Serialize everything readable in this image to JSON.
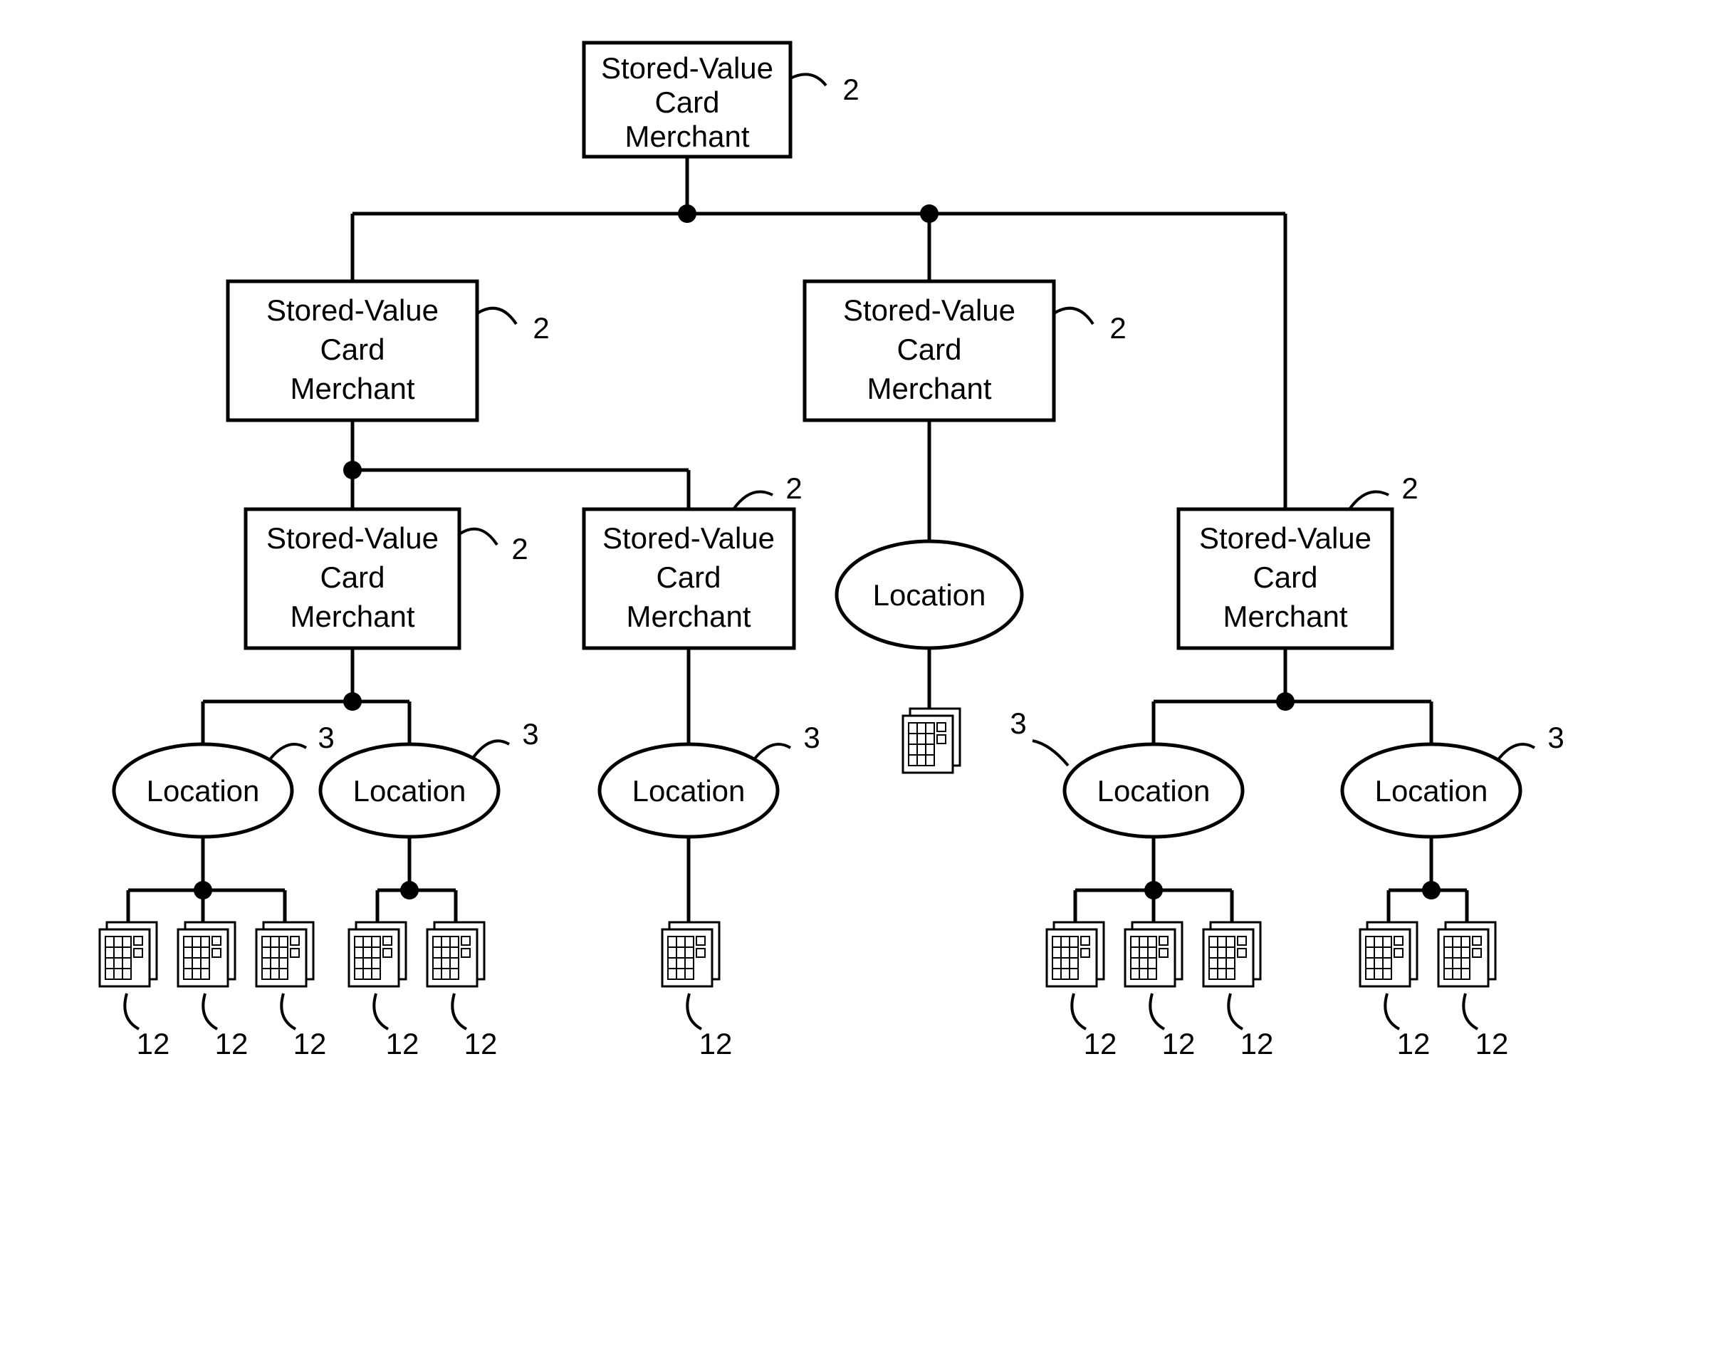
{
  "labels": {
    "merchant_l1": "Stored-Value",
    "merchant_l2": "Card",
    "merchant_l3": "Merchant",
    "location": "Location"
  },
  "refs": {
    "merchant": "2",
    "location": "3",
    "terminal": "12"
  }
}
